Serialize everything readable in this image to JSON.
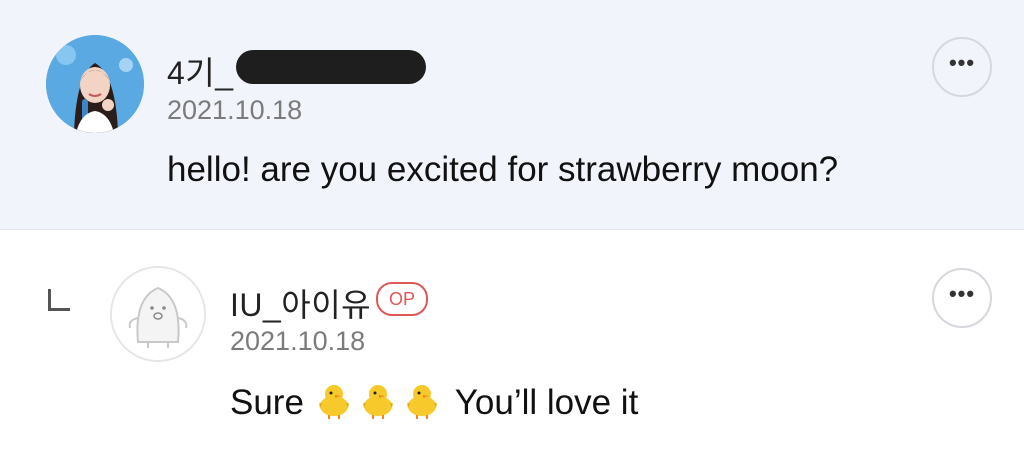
{
  "parent_comment": {
    "username": "4기_",
    "date": "2021.10.18",
    "text": "hello! are you excited for strawberry moon?",
    "more_label": "•••",
    "avatar": "user-photo-avatar"
  },
  "reply_comment": {
    "username": "IU_아이유",
    "op_badge": "OP",
    "date": "2021.10.18",
    "text_prefix": "Sure",
    "text_suffix": " You’ll love it",
    "emoji": "chick-emoji",
    "emoji_count": 3,
    "more_label": "•••",
    "avatar": "penguin-default-avatar",
    "reply_icon": "reply-indent-icon"
  },
  "colors": {
    "parent_background": "#f2f4fb",
    "op_badge": "#e05757",
    "date_text": "#7b7b7b"
  }
}
